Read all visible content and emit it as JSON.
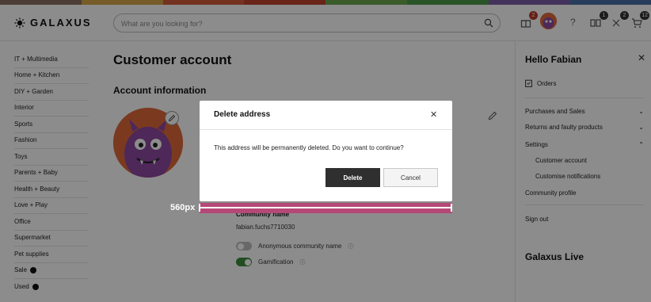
{
  "brand": {
    "logo_text": "GALAXUS",
    "colorbar": [
      "#8b6f63",
      "#d8a84a",
      "#d35b3c",
      "#c0442e",
      "#6aa84f",
      "#4e9a4a",
      "#7a5ea8",
      "#4a6fa8"
    ]
  },
  "header": {
    "search_placeholder": "What are you looking for?",
    "notification_badge": "2",
    "cart_badges": [
      "1",
      "2",
      "12"
    ]
  },
  "sidebar": {
    "items": [
      {
        "label": "IT + Multimedia"
      },
      {
        "label": "Home + Kitchen"
      },
      {
        "label": "DIY + Garden"
      },
      {
        "label": "Interior"
      },
      {
        "label": "Sports"
      },
      {
        "label": "Fashion"
      },
      {
        "label": "Toys"
      },
      {
        "label": "Parents + Baby"
      },
      {
        "label": "Health + Beauty"
      },
      {
        "label": "Love + Play"
      },
      {
        "label": "Office"
      },
      {
        "label": "Supermarket"
      },
      {
        "label": "Pet supplies"
      },
      {
        "label": "Sale"
      },
      {
        "label": "Used"
      }
    ]
  },
  "main": {
    "title": "Customer account",
    "section_title": "Account information",
    "community_label": "Community name",
    "community_value": "fabian.fuchs7710030",
    "toggles": [
      {
        "label": "Anonymous community name",
        "on": false
      },
      {
        "label": "Gamification",
        "on": true
      }
    ]
  },
  "right_panel": {
    "greeting": "Hello Fabian",
    "orders": "Orders",
    "purchases": "Purchases and Sales",
    "returns": "Returns and faulty products",
    "settings": "Settings",
    "customer_account": "Customer account",
    "customise": "Customise notifications",
    "community_profile": "Community profile",
    "sign_out": "Sign out",
    "live": "Galaxus Live"
  },
  "modal": {
    "title": "Delete address",
    "message": "This address will be permanently deleted. Do you want to continue?",
    "delete_label": "Delete",
    "cancel_label": "Cancel"
  },
  "measurement": {
    "label": "560px",
    "color": "#b54877"
  }
}
